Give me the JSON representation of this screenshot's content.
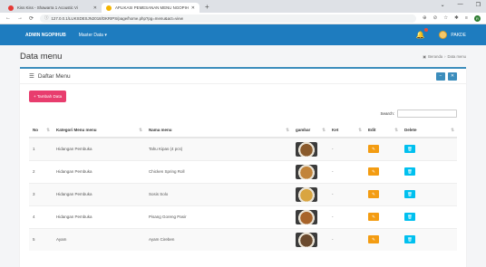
{
  "browser": {
    "tabs": [
      {
        "title": "Kiss Kiss - Shawarra 1 Acoustic Vi",
        "favicon_color": "#e53935"
      },
      {
        "title": "APLIKASI PEMESANAN MENU NGOPIHUB",
        "favicon_color": "#f4b400"
      }
    ],
    "url": "127.0.0.1/LUKSDESJN2018/DKRIPS/page/home.php?pg=menu&act=view"
  },
  "app": {
    "brand": "ADMIN NGOPIHUB",
    "menu_label": "Master Data ▾",
    "user_name": "PAKDE",
    "header_color": "#1e7cbf"
  },
  "page": {
    "title": "Data menu",
    "breadcrumb": [
      "Beranda",
      "Data menu"
    ]
  },
  "box": {
    "title": "Daftar Menu",
    "add_button": "+ Tambah Data",
    "search_label": "Search:",
    "search_value": ""
  },
  "table": {
    "columns": [
      "No",
      "Kategori Menu menu",
      "Nama menu",
      "gambar",
      "Ket",
      "Edit",
      "Delete"
    ],
    "rows": [
      {
        "no": "1",
        "kategori": "Hidangan Pembuka",
        "nama": "Tahu Kipas (4 pcs)",
        "ket": "-",
        "img": "#8a5a2b"
      },
      {
        "no": "2",
        "kategori": "Hidangan Pembuka",
        "nama": "Chicken Spring Roll",
        "ket": "-",
        "img": "#c2843a"
      },
      {
        "no": "3",
        "kategori": "Hidangan Pembuka",
        "nama": "Sosis Solo",
        "ket": "-",
        "img": "#d9a541"
      },
      {
        "no": "4",
        "kategori": "Hidangan Pembuka",
        "nama": "Pisang Goreng Pasir",
        "ket": "-",
        "img": "#a8642a"
      },
      {
        "no": "5",
        "kategori": "Ayam",
        "nama": "Ayam Cireben",
        "ket": "-",
        "img": "#6b4a2e"
      }
    ]
  }
}
